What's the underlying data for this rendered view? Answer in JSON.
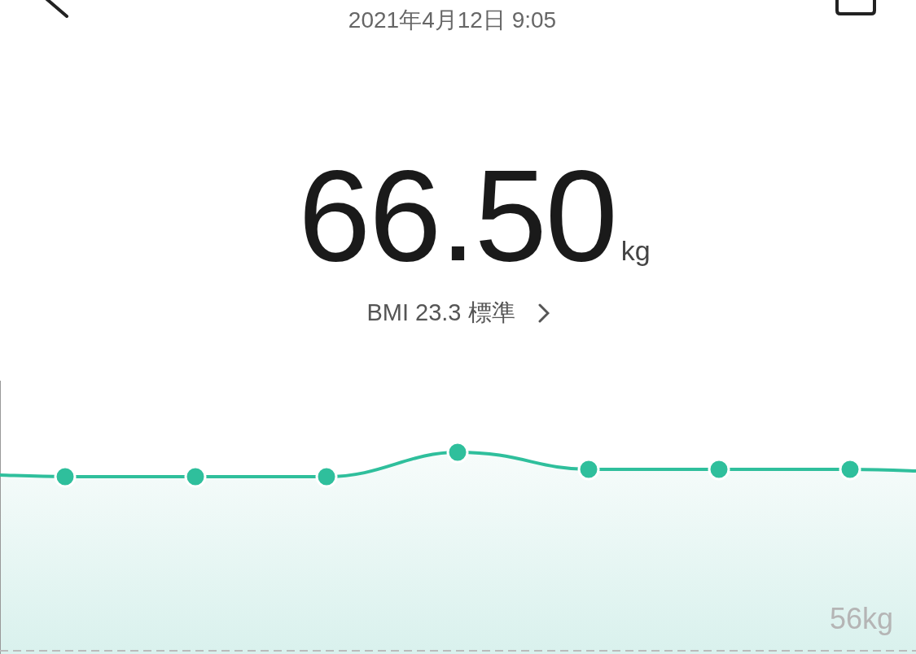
{
  "header": {
    "date": "2021年4月12日 9:05"
  },
  "weight": {
    "value": "66.50",
    "unit": "kg"
  },
  "bmi": {
    "text": "BMI 23.3 標準"
  },
  "chart": {
    "baseline_label": "56kg"
  }
}
